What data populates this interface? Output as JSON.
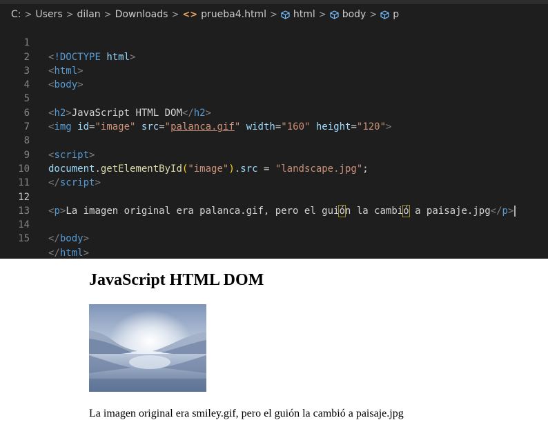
{
  "breadcrumb": {
    "drive": "C:",
    "folders": [
      "Users",
      "dilan",
      "Downloads"
    ],
    "file": "prueba4.html",
    "symbols": [
      "html",
      "body",
      "p"
    ]
  },
  "editor": {
    "active_line": 12,
    "lines": [
      {
        "n": "1"
      },
      {
        "n": "2"
      },
      {
        "n": "3"
      },
      {
        "n": "4"
      },
      {
        "n": "5"
      },
      {
        "n": "6"
      },
      {
        "n": "7"
      },
      {
        "n": "8"
      },
      {
        "n": "9"
      },
      {
        "n": "10"
      },
      {
        "n": "11"
      },
      {
        "n": "12"
      },
      {
        "n": "13"
      },
      {
        "n": "14"
      },
      {
        "n": "15"
      }
    ],
    "code": {
      "doctype_kw": "!DOCTYPE",
      "doctype_val": "html",
      "html_tag": "html",
      "body_tag": "body",
      "h2_tag": "h2",
      "h2_text": "JavaScript HTML DOM",
      "img_tag": "img",
      "img_id_attr": "id",
      "img_id_val": "\"image\"",
      "img_src_attr": "src",
      "img_src_val_q": "\"",
      "img_src_val": "palanca.gif",
      "img_w_attr": "width",
      "img_w_val": "\"160\"",
      "img_h_attr": "height",
      "img_h_val": "\"120\"",
      "script_tag": "script",
      "js_obj": "document",
      "js_fn": "getElementById",
      "js_arg": "\"image\"",
      "js_prop": "src",
      "js_val": "\"landscape.jpg\"",
      "p_tag": "p",
      "p_text_a": "La imagen original era palanca.gif, pero el gui",
      "p_text_o1": "ó",
      "p_text_b": "n la cambi",
      "p_text_o2": "ó",
      "p_text_c": " a paisaje.jpg"
    }
  },
  "preview": {
    "heading": "JavaScript HTML DOM",
    "paragraph": "La imagen original era smiley.gif, pero el guión la cambió a paisaje.jpg"
  },
  "colors": {
    "editor_bg": "#1e1e1e",
    "tag": "#569cd6",
    "attr": "#9cdcfe",
    "string": "#ce9178",
    "function": "#dcdcaa",
    "bracket_match": "#a08d2c"
  }
}
